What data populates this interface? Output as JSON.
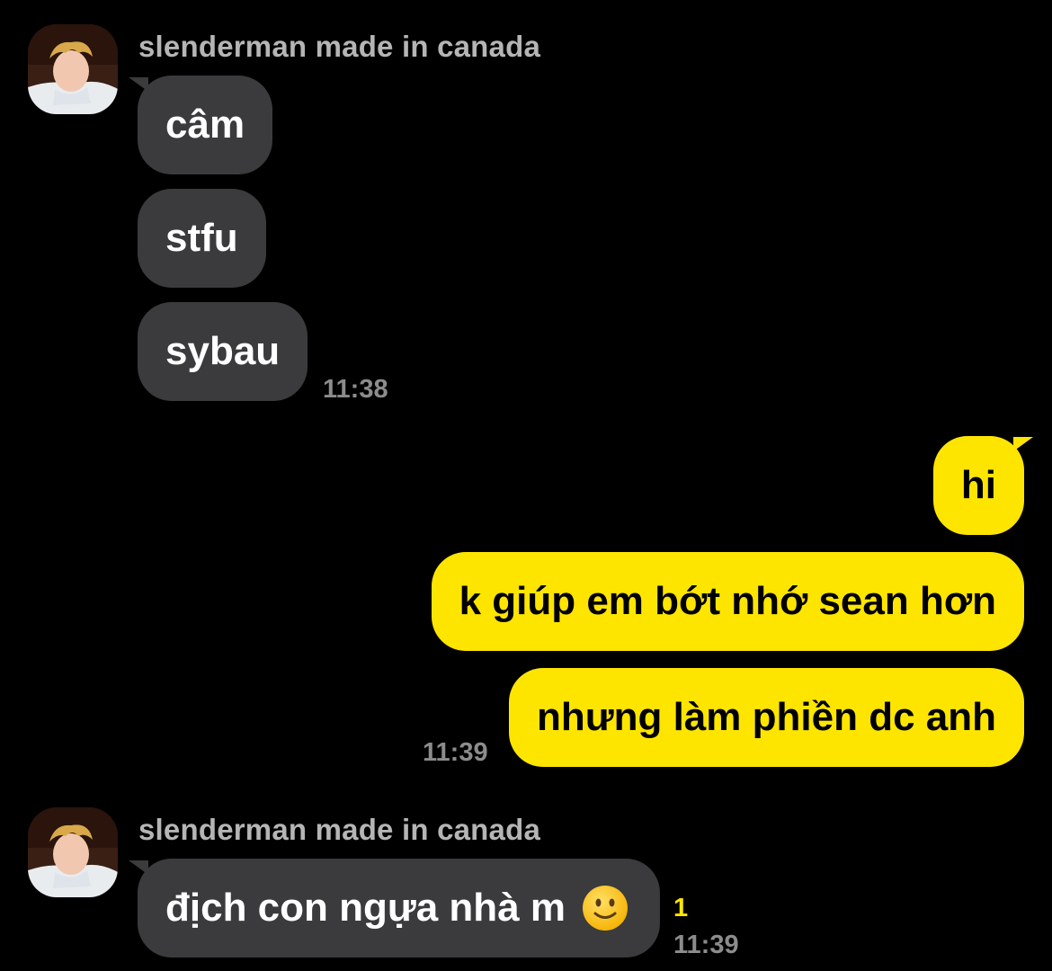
{
  "messages": {
    "group1": {
      "sender": "slenderman made in canada",
      "bubbles": [
        "câm",
        "stfu",
        "sybau"
      ],
      "time": "11:38"
    },
    "group2": {
      "bubbles": [
        "hi",
        "k giúp em bớt nhớ sean hơn",
        "nhưng làm phiền dc anh"
      ],
      "time": "11:39"
    },
    "group3": {
      "sender": "slenderman made in canada",
      "bubble_text": "địch con ngựa nhà m",
      "emoji": "slightly-smiling-face",
      "unread_count": "1",
      "time": "11:39"
    }
  },
  "colors": {
    "background": "#000000",
    "incoming_bubble": "#3b3b3d",
    "outgoing_bubble": "#fee500",
    "accent": "#fee500"
  }
}
